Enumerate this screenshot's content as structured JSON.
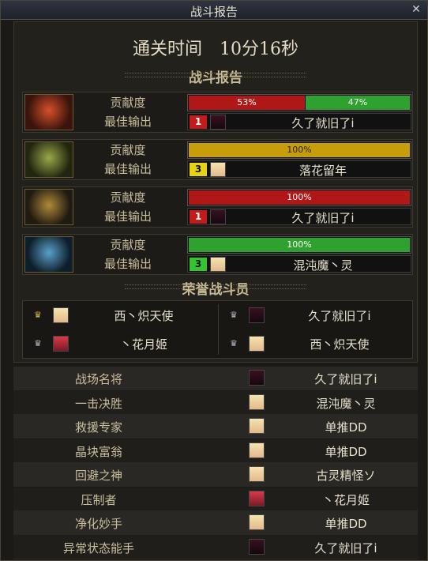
{
  "window": {
    "title": "战斗报告",
    "close_icon": "close-icon"
  },
  "clear_time": "通关时间　10分16秒",
  "battle_report_header": "战斗报告",
  "honor_header": "荣誉战斗员",
  "colors": {
    "red_bar": "#b01818",
    "green_bar": "#2ea12e",
    "yellow_bar": "#c79e0a",
    "rank_red": "#c21b1b",
    "rank_yellow": "#e6d210",
    "rank_green": "#35c42f"
  },
  "bosses": [
    {
      "icon": "fire-boss-emblem-icon",
      "contribution_label": "贡献度",
      "best_label": "最佳输出",
      "segments": [
        {
          "text": "53%",
          "value": 53,
          "color": "red"
        },
        {
          "text": "47%",
          "value": 47,
          "color": "green"
        }
      ],
      "rank": "1",
      "rank_color": "red",
      "player": "久了就旧了i",
      "avatar_icon": "dark-avatar-icon"
    },
    {
      "icon": "nature-boss-emblem-icon",
      "contribution_label": "贡献度",
      "best_label": "最佳输出",
      "segments": [
        {
          "text": "100%",
          "value": 100,
          "color": "yellow"
        }
      ],
      "rank": "3",
      "rank_color": "yellow",
      "player": "落花留年",
      "avatar_icon": "blonde-avatar-icon"
    },
    {
      "icon": "shadow-boss-emblem-icon",
      "contribution_label": "贡献度",
      "best_label": "最佳输出",
      "segments": [
        {
          "text": "100%",
          "value": 100,
          "color": "red"
        }
      ],
      "rank": "1",
      "rank_color": "red",
      "player": "久了就旧了i",
      "avatar_icon": "dark-avatar-icon"
    },
    {
      "icon": "ice-boss-emblem-icon",
      "contribution_label": "贡献度",
      "best_label": "最佳输出",
      "segments": [
        {
          "text": "100%",
          "value": 100,
          "color": "green"
        }
      ],
      "rank": "3",
      "rank_color": "green",
      "player": "混沌魔丶灵",
      "avatar_icon": "blonde-avatar-icon"
    }
  ],
  "honor": [
    {
      "name": "西丶炽天使",
      "avatar_icon": "blonde-avatar-icon",
      "badge_icon": "gold-crown-icon"
    },
    {
      "name": "久了就旧了i",
      "avatar_icon": "dark-avatar-icon",
      "badge_icon": "silver-crown-icon"
    },
    {
      "name": "丶花月姬",
      "avatar_icon": "red-hair-avatar-icon",
      "badge_icon": "silver-crown-icon"
    },
    {
      "name": "西丶炽天使",
      "avatar_icon": "blonde-avatar-icon",
      "badge_icon": "silver-crown-icon"
    }
  ],
  "awards": [
    {
      "title": "战场名将",
      "player": "久了就旧了i",
      "avatar_icon": "dark-avatar-icon"
    },
    {
      "title": "一击决胜",
      "player": "混沌魔丶灵",
      "avatar_icon": "blonde-avatar-icon"
    },
    {
      "title": "救援专家",
      "player": "单推DD",
      "avatar_icon": "blonde-avatar-icon"
    },
    {
      "title": "晶块富翁",
      "player": "单推DD",
      "avatar_icon": "blonde-avatar-icon"
    },
    {
      "title": "回避之神",
      "player": "古灵精怪ソ",
      "avatar_icon": "blonde-avatar-icon"
    },
    {
      "title": "压制者",
      "player": "丶花月姬",
      "avatar_icon": "red-hair-avatar-icon"
    },
    {
      "title": "净化妙手",
      "player": "单推DD",
      "avatar_icon": "blonde-avatar-icon"
    },
    {
      "title": "异常状态能手",
      "player": "久了就旧了i",
      "avatar_icon": "dark-avatar-icon"
    }
  ]
}
